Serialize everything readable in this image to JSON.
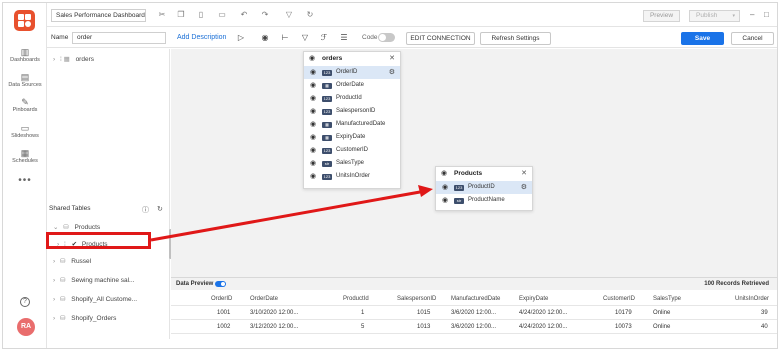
{
  "topbar": {
    "dashboard_title": "Sales Performance Dashboard",
    "preview_label": "Preview",
    "publish_label": "Publish"
  },
  "toolbar": {
    "name_label": "Name",
    "name_value": "order",
    "add_description": "Add Description",
    "code_label": "Code",
    "edit_connection": "EDIT CONNECTION",
    "refresh_settings": "Refresh Settings",
    "save_label": "Save",
    "cancel_label": "Cancel"
  },
  "nav": {
    "items": [
      {
        "label": "Dashboards",
        "icon": "dashboard-icon"
      },
      {
        "label": "Data Sources",
        "icon": "data-sources-icon"
      },
      {
        "label": "Pinboards",
        "icon": "pin-icon"
      },
      {
        "label": "Slideshows",
        "icon": "slideshow-icon"
      },
      {
        "label": "Schedules",
        "icon": "calendar-icon"
      }
    ],
    "more": "•••",
    "avatar": "RA"
  },
  "left_panel": {
    "top_item": "orders",
    "shared_tables_title": "Shared Tables",
    "shared_tables": [
      "Products",
      "Products",
      "Russel",
      "Sewing machine sal...",
      "Shopify_All Custome...",
      "Shopify_Orders"
    ]
  },
  "orders_card": {
    "title": "orders",
    "fields": [
      {
        "name": "OrderID",
        "type": "123"
      },
      {
        "name": "OrderDate",
        "type": "cal"
      },
      {
        "name": "ProductId",
        "type": "123"
      },
      {
        "name": "SalespersonID",
        "type": "123"
      },
      {
        "name": "ManufacturedDate",
        "type": "cal"
      },
      {
        "name": "ExpiryDate",
        "type": "cal"
      },
      {
        "name": "CustomerID",
        "type": "123"
      },
      {
        "name": "SalesType",
        "type": "str"
      },
      {
        "name": "UnitsInOrder",
        "type": "123"
      }
    ]
  },
  "products_card": {
    "title": "Products",
    "fields": [
      {
        "name": "ProductID",
        "type": "123"
      },
      {
        "name": "ProductName",
        "type": "str"
      }
    ]
  },
  "preview": {
    "title": "Data Preview",
    "count": "100 Records Retrieved",
    "columns": [
      "OrderID",
      "OrderDate",
      "ProductId",
      "SalespersonID",
      "ManufacturedDate",
      "ExpiryDate",
      "CustomerID",
      "SalesType",
      "UnitsInOrder"
    ],
    "rows": [
      [
        "1001",
        "3/10/2020 12:00...",
        "1",
        "1015",
        "3/6/2020 12:00...",
        "4/24/2020 12:00...",
        "10179",
        "Online",
        "39"
      ],
      [
        "1002",
        "3/12/2020 12:00...",
        "5",
        "1013",
        "3/6/2020 12:00...",
        "4/24/2020 12:00...",
        "10073",
        "Online",
        "40"
      ]
    ]
  },
  "colors": {
    "accent": "#1a73e8",
    "brand": "#e8512e",
    "annotation": "#e01818",
    "badge": "#3d4e6c"
  }
}
